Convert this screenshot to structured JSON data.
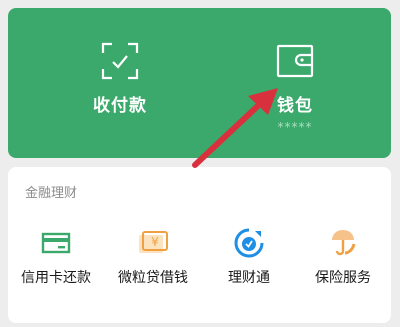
{
  "top_panel": {
    "background": "#3aa96b",
    "pay": {
      "label": "收付款",
      "icon": "scan-check-icon"
    },
    "wallet": {
      "label": "钱包",
      "balance_masked": "*****",
      "icon": "wallet-icon"
    }
  },
  "finance": {
    "title": "金融理财",
    "items": [
      {
        "label": "信用卡还款",
        "icon": "credit-card-icon",
        "color": "#3aa96b"
      },
      {
        "label": "微粒贷借钱",
        "icon": "yen-card-icon",
        "color": "#f0a040"
      },
      {
        "label": "理财通",
        "icon": "licaitong-icon",
        "color": "#1e8fe6"
      },
      {
        "label": "保险服务",
        "icon": "umbrella-hand-icon",
        "color": "#f0a040"
      }
    ]
  },
  "annotation": {
    "type": "arrow",
    "color": "#d9303e",
    "points_to": "wallet"
  }
}
